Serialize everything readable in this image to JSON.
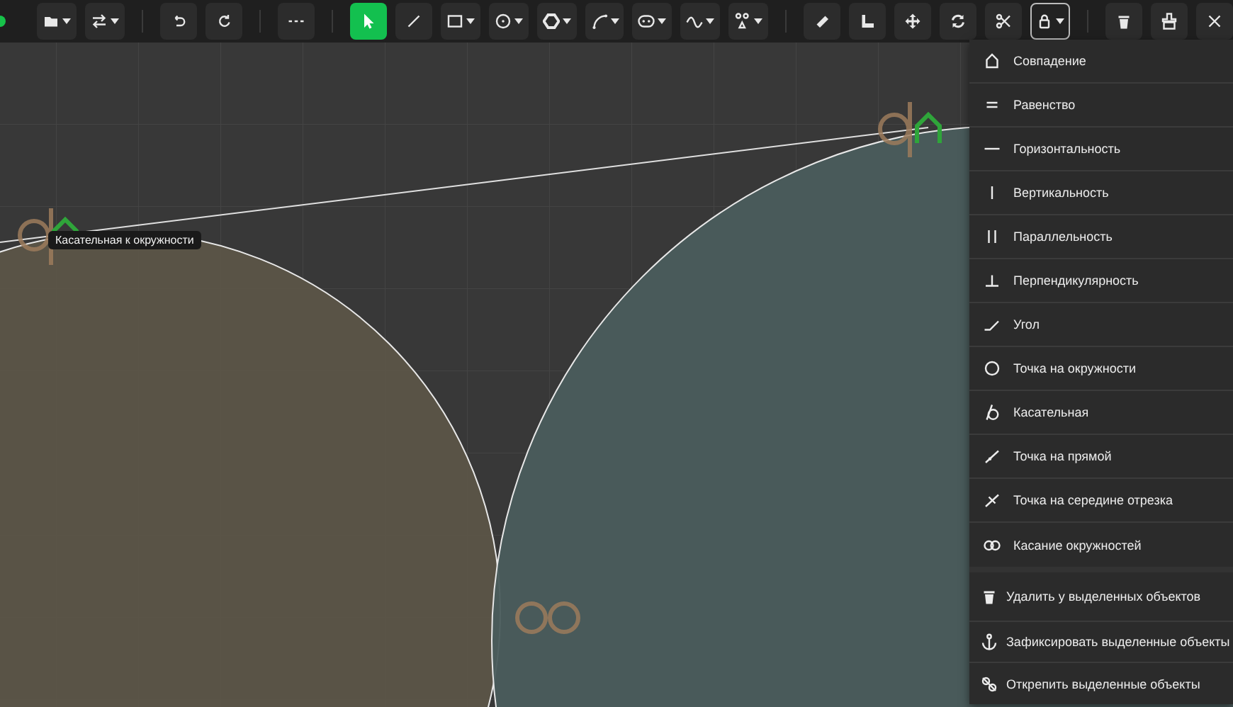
{
  "toolbar": {
    "groups": [
      [
        {
          "kind": "folder",
          "caret": true,
          "selected": false
        },
        {
          "kind": "swap",
          "caret": true,
          "selected": false
        }
      ],
      [
        {
          "kind": "undo",
          "caret": false,
          "selected": false
        },
        {
          "kind": "redo",
          "caret": false,
          "selected": false
        }
      ],
      [
        {
          "kind": "dashes",
          "caret": false,
          "selected": false
        }
      ],
      [
        {
          "kind": "pointer",
          "caret": false,
          "selected": true
        },
        {
          "kind": "line",
          "caret": false,
          "selected": false
        },
        {
          "kind": "rect",
          "caret": true,
          "selected": false
        },
        {
          "kind": "circle",
          "caret": true,
          "selected": false
        },
        {
          "kind": "polygon",
          "caret": true,
          "selected": false
        },
        {
          "kind": "arc",
          "caret": true,
          "selected": false
        },
        {
          "kind": "slot",
          "caret": true,
          "selected": false
        },
        {
          "kind": "wave",
          "caret": true,
          "selected": false
        },
        {
          "kind": "points",
          "caret": true,
          "selected": false
        }
      ],
      [
        {
          "kind": "ruler",
          "caret": false,
          "selected": false
        },
        {
          "kind": "corner",
          "caret": false,
          "selected": false
        },
        {
          "kind": "move",
          "caret": false,
          "selected": false
        },
        {
          "kind": "rotate",
          "caret": false,
          "selected": false
        },
        {
          "kind": "scissors",
          "caret": false,
          "selected": false
        },
        {
          "kind": "lock",
          "caret": true,
          "selected": true
        }
      ],
      [
        {
          "kind": "trash",
          "caret": false,
          "selected": false
        },
        {
          "kind": "broom",
          "caret": false,
          "selected": false
        },
        {
          "kind": "close",
          "caret": false,
          "selected": false
        }
      ]
    ]
  },
  "canvas": {
    "tooltip": "Касательная к окружности"
  },
  "menu": {
    "sections": [
      [
        {
          "kind": "coincident",
          "label": "Совпадение"
        },
        {
          "kind": "equal",
          "label": "Равенство"
        },
        {
          "kind": "horizontal",
          "label": "Горизонтальность"
        },
        {
          "kind": "vertical",
          "label": "Вертикальность"
        },
        {
          "kind": "parallel",
          "label": "Параллельность"
        },
        {
          "kind": "perpendicular",
          "label": "Перпендикулярность"
        },
        {
          "kind": "angle",
          "label": "Угол"
        },
        {
          "kind": "on-circle",
          "label": "Точка на окружности"
        },
        {
          "kind": "tangent",
          "label": "Касательная"
        },
        {
          "kind": "on-line",
          "label": "Точка на прямой"
        },
        {
          "kind": "midpoint",
          "label": "Точка на середине отрезка"
        },
        {
          "kind": "circles-touch",
          "label": "Касание окружностей"
        }
      ],
      [
        {
          "kind": "trash",
          "label": "Удалить у выделенных объектов"
        },
        {
          "kind": "anchor",
          "label": "Зафиксировать выделенные объекты"
        },
        {
          "kind": "unlink",
          "label": "Открепить выделенные объекты"
        }
      ]
    ]
  }
}
